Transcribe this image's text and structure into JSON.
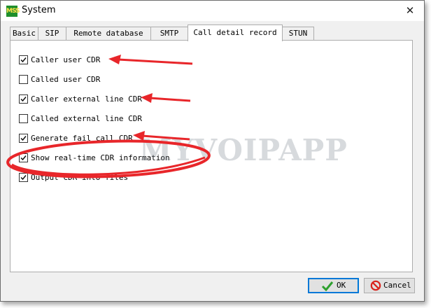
{
  "window": {
    "title": "System",
    "logo_text": "MSS",
    "close_glyph": "✕"
  },
  "tabs": [
    {
      "label": "Basic",
      "active": false
    },
    {
      "label": "SIP",
      "active": false
    },
    {
      "label": "Remote database",
      "active": false
    },
    {
      "label": "SMTP",
      "active": false
    },
    {
      "label": "Call detail record",
      "active": true
    },
    {
      "label": "STUN",
      "active": false
    }
  ],
  "options": [
    {
      "label": "Caller user CDR",
      "checked": true
    },
    {
      "label": "Called user CDR",
      "checked": false
    },
    {
      "label": "Caller external line CDR",
      "checked": true
    },
    {
      "label": "Called external line CDR",
      "checked": false
    },
    {
      "label": "Generate fail call CDR",
      "checked": true
    },
    {
      "label": "Show real-time CDR information",
      "checked": true
    },
    {
      "label": "Output CDR into files",
      "checked": true
    }
  ],
  "watermark": "MYVOIPAPP",
  "annotation_color": "#e8262a",
  "buttons": {
    "ok_label": "OK",
    "cancel_label": "Cancel"
  },
  "colors": {
    "ok_check": "#2ea02e",
    "cancel_icon": "#d9231c",
    "focus_border": "#0078d7"
  }
}
